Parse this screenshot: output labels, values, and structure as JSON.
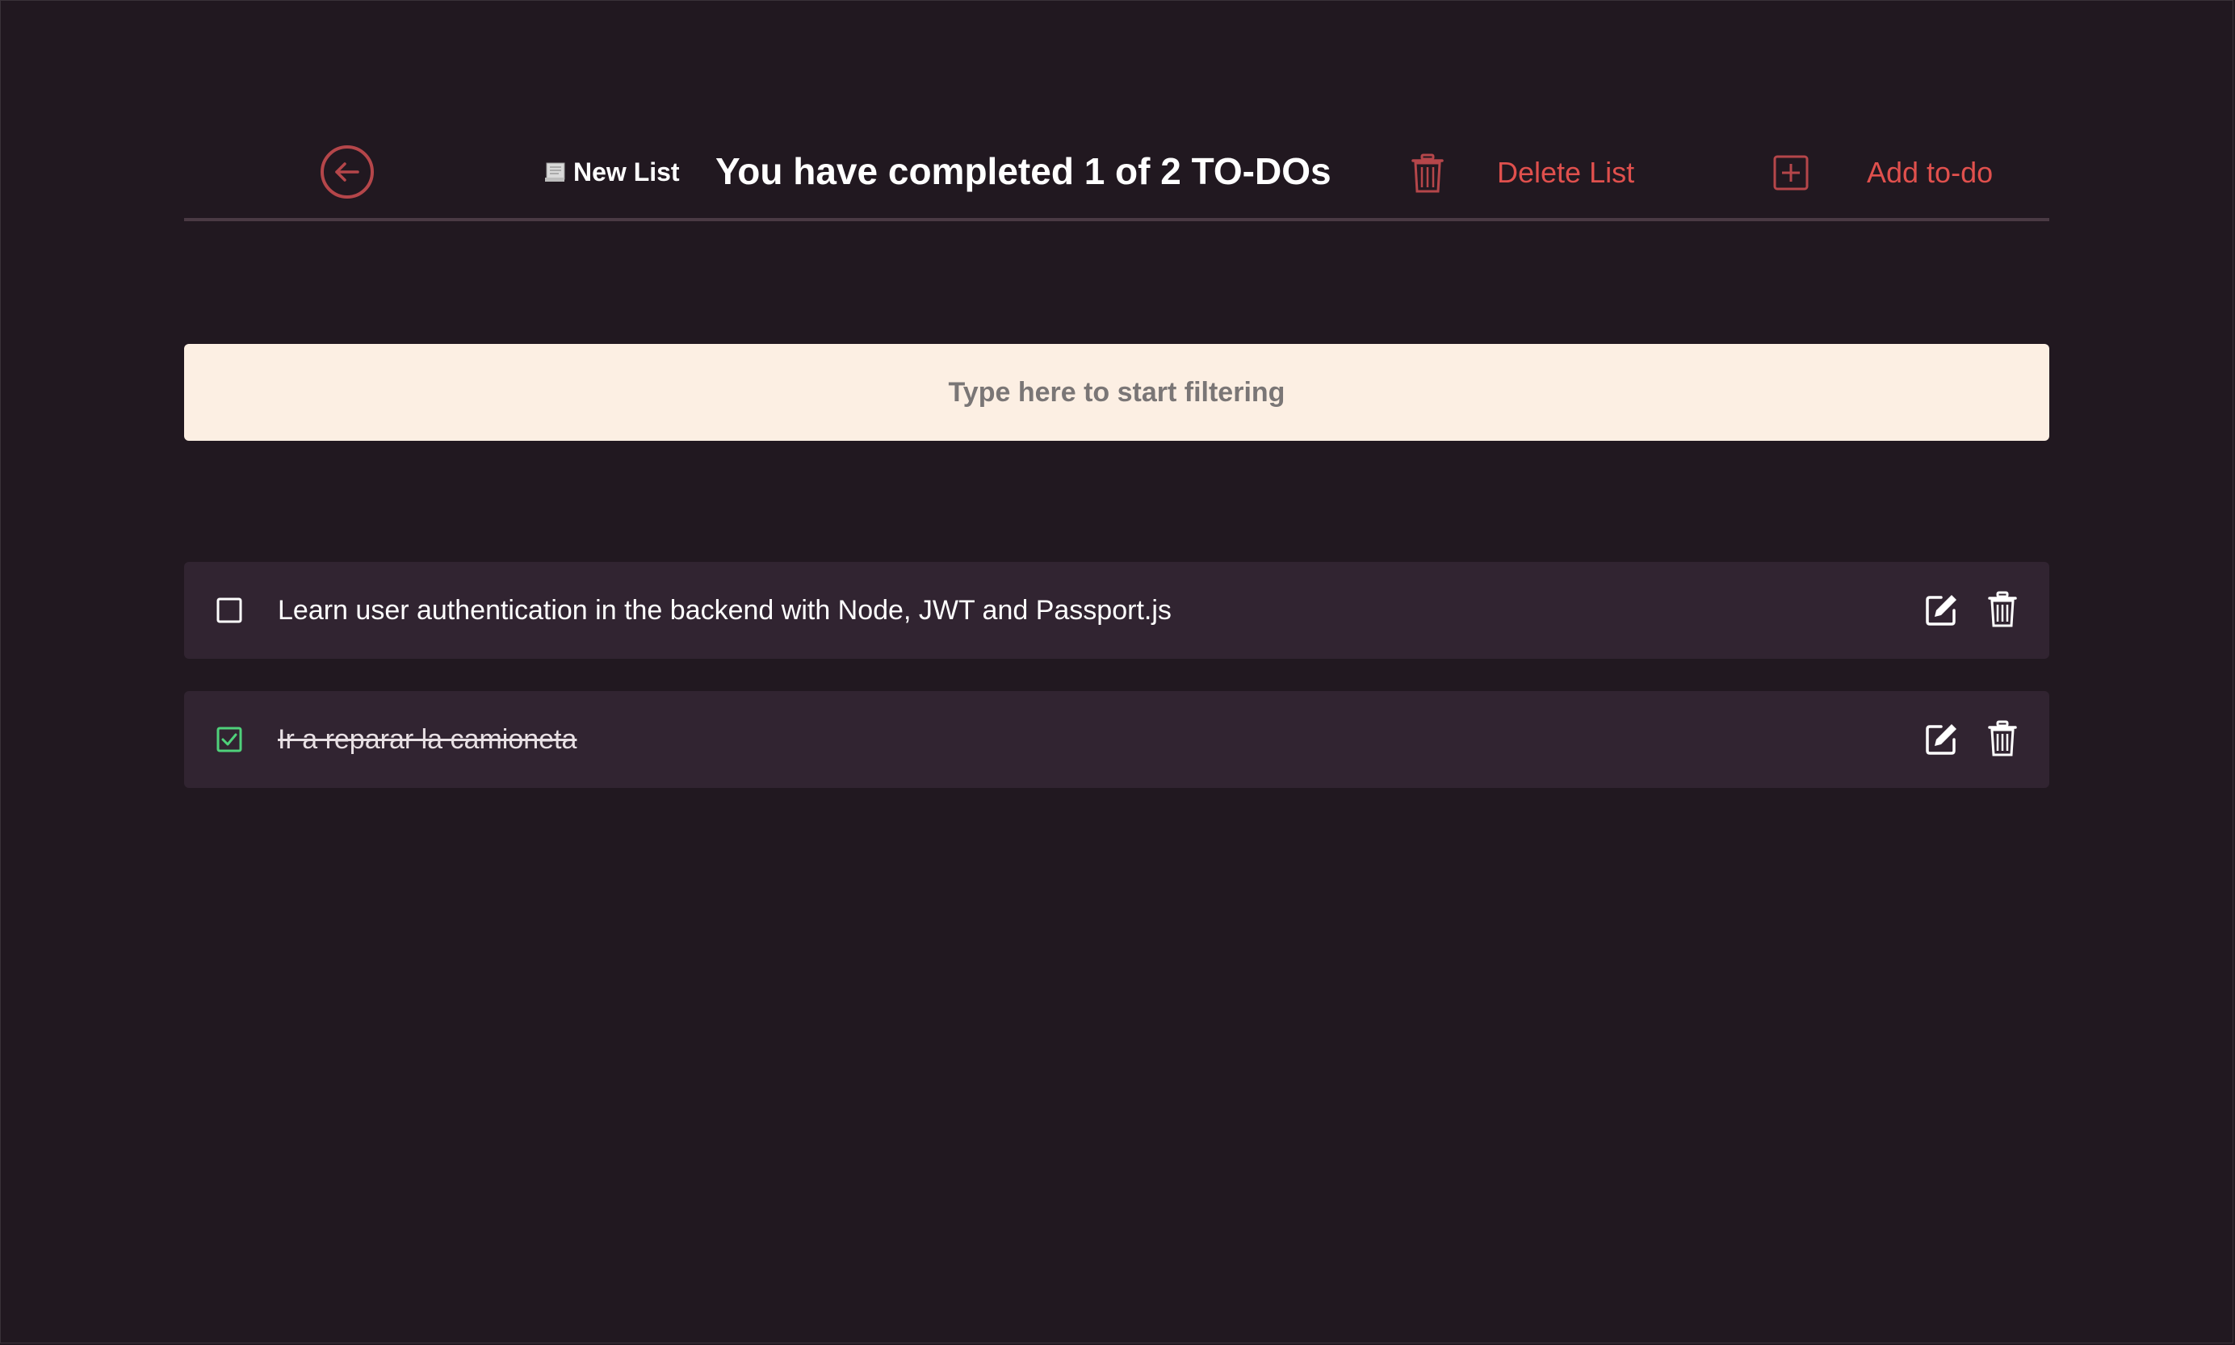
{
  "header": {
    "list_name": "New List",
    "title": "You have completed 1 of 2 TO-DOs",
    "delete_list_label": "Delete List",
    "add_todo_label": "Add to-do"
  },
  "filter": {
    "placeholder": "Type here to start filtering",
    "value": ""
  },
  "todos": [
    {
      "text": "Learn user authentication in the backend with Node, JWT and Passport.js",
      "completed": false
    },
    {
      "text": "Ir a reparar la camioneta",
      "completed": true
    }
  ],
  "colors": {
    "background": "#211820",
    "accent": "#e0504d",
    "row_background": "#312431",
    "filter_background": "#fcefe3",
    "checked_green": "#4fd17a"
  },
  "icons": {
    "back": "arrow-left-circle-icon",
    "list_name": "document-icon",
    "delete_list": "trash-icon",
    "add_todo": "plus-square-icon",
    "edit": "edit-icon",
    "delete": "trash-icon"
  }
}
